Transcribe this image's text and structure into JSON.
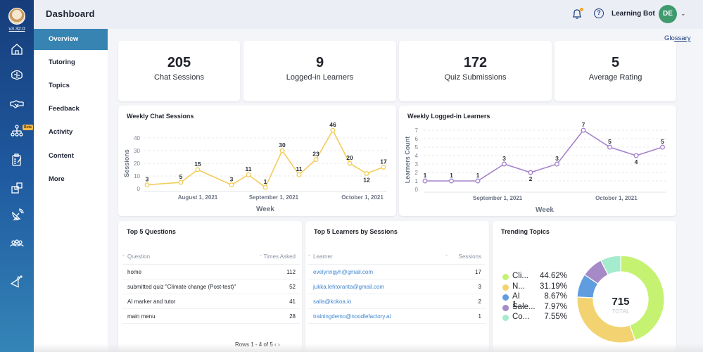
{
  "app": {
    "version": "v3.32.0",
    "page_title": "Dashboard",
    "user_name": "Learning Bot",
    "user_initials": "DE",
    "glossary_link": "Glossary",
    "beta_badge": "Beta"
  },
  "rail_icons": [
    "avatar-logo",
    "home-icon",
    "brain-icon",
    "handshake-icon",
    "hierarchy-icon",
    "clipboard-icon",
    "puzzle-icon",
    "satellite-icon",
    "users-icon",
    "flask-icon"
  ],
  "subnav": {
    "items": [
      {
        "label": "Overview",
        "active": true
      },
      {
        "label": "Tutoring",
        "active": false
      },
      {
        "label": "Topics",
        "active": false
      },
      {
        "label": "Feedback",
        "active": false
      },
      {
        "label": "Activity",
        "active": false
      },
      {
        "label": "Content",
        "active": false
      },
      {
        "label": "More",
        "active": false
      }
    ]
  },
  "stats": [
    {
      "value": "205",
      "label": "Chat Sessions"
    },
    {
      "value": "9",
      "label": "Logged-in Learners"
    },
    {
      "value": "172",
      "label": "Quiz Submissions"
    },
    {
      "value": "5",
      "label": "Average Rating"
    }
  ],
  "chart_data": [
    {
      "type": "line",
      "title": "Weekly Chat Sessions",
      "xlabel": "Week",
      "ylabel": "Sessions",
      "color": "#f2cd5c",
      "ylim": [
        0,
        46
      ],
      "yticks": [
        0,
        10,
        20,
        30,
        40
      ],
      "x_week_index": [
        0,
        2,
        3,
        5,
        6,
        7,
        8,
        9,
        10,
        11,
        12,
        13,
        14
      ],
      "values": [
        3,
        5,
        15,
        3,
        11,
        1,
        30,
        11,
        23,
        46,
        20,
        12,
        17
      ],
      "label_below": [
        false,
        false,
        false,
        false,
        false,
        false,
        false,
        false,
        false,
        false,
        false,
        true,
        false
      ],
      "xtick_labels": [
        {
          "label": "August 1, 2021",
          "week_index": 3
        },
        {
          "label": "September 1, 2021",
          "week_index": 7.5
        },
        {
          "label": "October 1, 2021",
          "week_index": 12.75
        }
      ],
      "grid": true
    },
    {
      "type": "line",
      "title": "Weekly Logged-in Learners",
      "xlabel": "Week",
      "ylabel": "Learners Count",
      "color": "#a583cc",
      "ylim": [
        0,
        7
      ],
      "yticks": [
        0,
        1,
        2,
        3,
        4,
        5,
        6,
        7
      ],
      "x_week_index": [
        0,
        1,
        2,
        3,
        4,
        5,
        6,
        7,
        8,
        9
      ],
      "values": [
        1,
        1,
        1,
        3,
        2,
        3,
        7,
        5,
        4,
        5
      ],
      "label_below": [
        false,
        false,
        false,
        false,
        true,
        false,
        false,
        false,
        true,
        false
      ],
      "xtick_labels": [
        {
          "label": "September 1, 2021",
          "week_index": 2.75
        },
        {
          "label": "October 1, 2021",
          "week_index": 7.25
        }
      ],
      "grid": true
    },
    {
      "type": "pie",
      "title": "Trending Topics",
      "total": 715,
      "total_label": "TOTAL",
      "slices": [
        {
          "name": "Cli...",
          "percent": 44.62,
          "color": "#c5f271"
        },
        {
          "name": "N...",
          "percent": 31.19,
          "color": "#f3d271"
        },
        {
          "name": "AI 1...",
          "percent": 8.67,
          "color": "#5f9ddf"
        },
        {
          "name": "Sale...",
          "percent": 7.97,
          "color": "#a68ac7"
        },
        {
          "name": "Co...",
          "percent": 7.55,
          "color": "#a5ebcd"
        }
      ],
      "legend": "left"
    }
  ],
  "top_questions": {
    "title": "Top 5 Questions",
    "columns": [
      "Question",
      "Times Asked"
    ],
    "rows": [
      [
        "home",
        "112"
      ],
      [
        "submitted quiz \"Climate change (Post-test)\"",
        "52"
      ],
      [
        "AI marker and tutor",
        "41"
      ],
      [
        "main menu",
        "28"
      ]
    ],
    "pager": "Rows 1 - 4 of 5"
  },
  "top_learners": {
    "title": "Top 5 Learners by Sessions",
    "columns": [
      "Learner",
      "Sessions"
    ],
    "rows": [
      [
        "evelynngyh@gmail.com",
        "17"
      ],
      [
        "jukka.lehtoranta@gmail.com",
        "3"
      ],
      [
        "saila@kokoa.io",
        "2"
      ],
      [
        "trainingdemo@noodlefactory.ai",
        "1"
      ]
    ]
  }
}
